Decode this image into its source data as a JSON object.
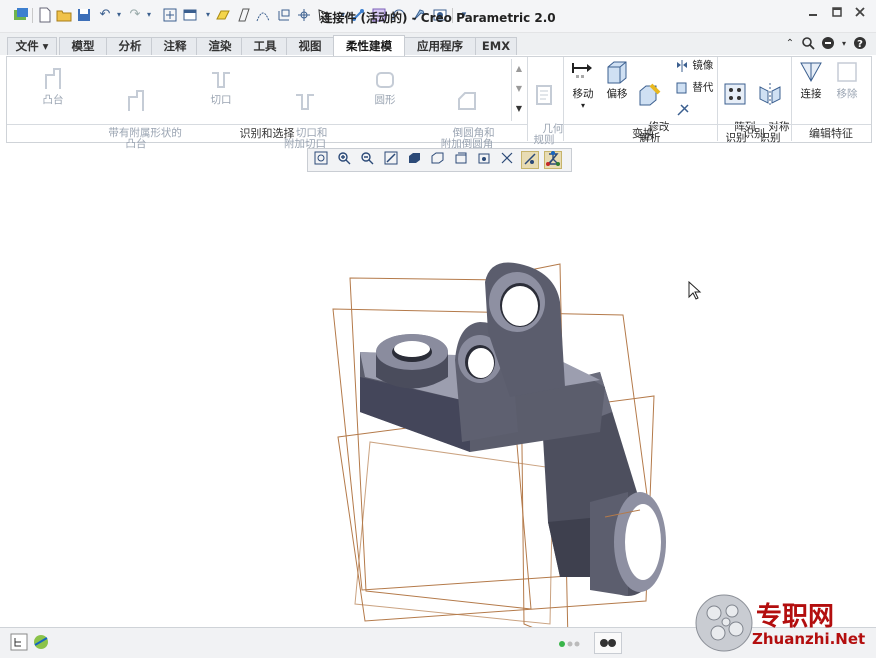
{
  "window": {
    "title": "连接件 (活动的) - Creo Parametric 2.0"
  },
  "tabs": [
    {
      "label": "文件 ▾"
    },
    {
      "label": "模型"
    },
    {
      "label": "分析"
    },
    {
      "label": "注释"
    },
    {
      "label": "渲染"
    },
    {
      "label": "工具"
    },
    {
      "label": "视图"
    },
    {
      "label": "柔性建模"
    },
    {
      "label": "应用程序"
    },
    {
      "label": "EMX"
    }
  ],
  "active_tab": "柔性建模",
  "ribbon": {
    "identify": {
      "items": [
        "凸台",
        "带有附属形状的\n凸台",
        "切口",
        "切口和\n附加切口",
        "圆形",
        "倒圆角和\n附加倒圆角"
      ],
      "group_label": "识别和选择"
    },
    "geometry_rule": "几何\n规则",
    "transform": {
      "move": "移动",
      "offset": "偏移",
      "modify": "修改\n解析",
      "mirror": "镜像",
      "replace": "替代",
      "group_label": "变换"
    },
    "recognize": {
      "pattern": "阵列\n识别",
      "symmetry": "对称\n识别",
      "group_label": "识别"
    },
    "edit_feature": {
      "attach": "连接",
      "remove": "移除",
      "group_label": "编辑特征"
    }
  },
  "watermark": {
    "text": "专职网",
    "url": "Zhuanzhi.Net"
  }
}
